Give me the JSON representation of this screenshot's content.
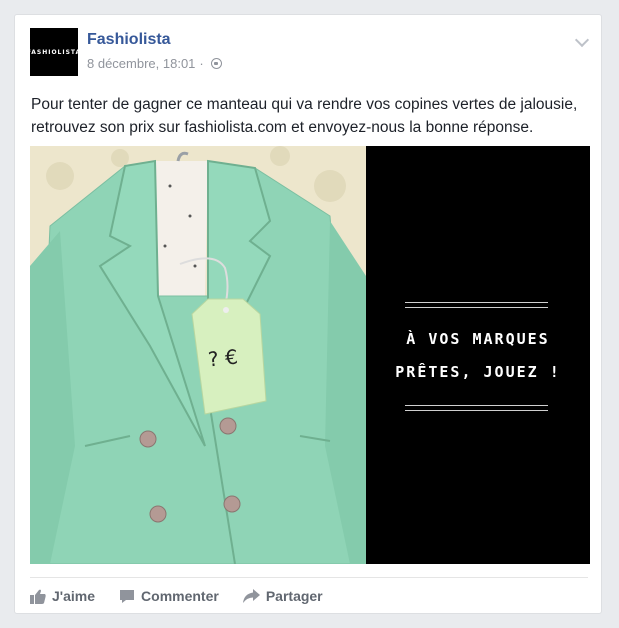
{
  "post": {
    "page_name": "Fashiolista",
    "avatar_text": "FASHIOLISTA",
    "timestamp": "8 décembre, 18:01",
    "separator": "·",
    "audience_icon": "globe-icon",
    "options_icon": "chevron-down-icon",
    "text": "Pour tenter de gagner ce manteau qui va rendre vos copines vertes de jalousie, retrouvez son prix sur fashiolista.com et envoyez-nous la bonne réponse."
  },
  "media": {
    "price_tag": "? €",
    "promo_line1": "À VOS MARQUES",
    "promo_line2": "PRÊTES, JOUEZ !",
    "coat_color": "#8fd4b6",
    "panel_color": "#000000"
  },
  "actions": {
    "like": "J'aime",
    "comment": "Commenter",
    "share": "Partager"
  },
  "colors": {
    "link": "#365899",
    "meta": "#90949c",
    "action": "#616770"
  }
}
